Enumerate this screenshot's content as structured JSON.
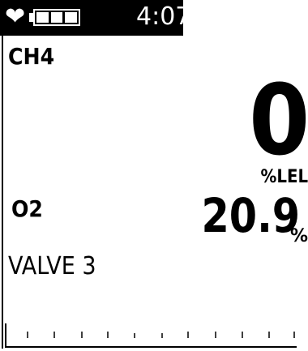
{
  "status_bar": {
    "icons": [
      "heart-icon",
      "battery-icon"
    ],
    "battery_level": 1.0,
    "time": "4:07"
  },
  "readings": [
    {
      "gas": "CH4",
      "value": "0",
      "unit": "%LEL"
    },
    {
      "gas": "O2",
      "value": "20.9",
      "unit": "%"
    }
  ],
  "valve": {
    "label": "VALVE",
    "number": "3"
  },
  "colors": {
    "background": "#ffffff",
    "foreground": "#000000",
    "status_bar_bg": "#000000",
    "status_bar_fg": "#ffffff"
  }
}
